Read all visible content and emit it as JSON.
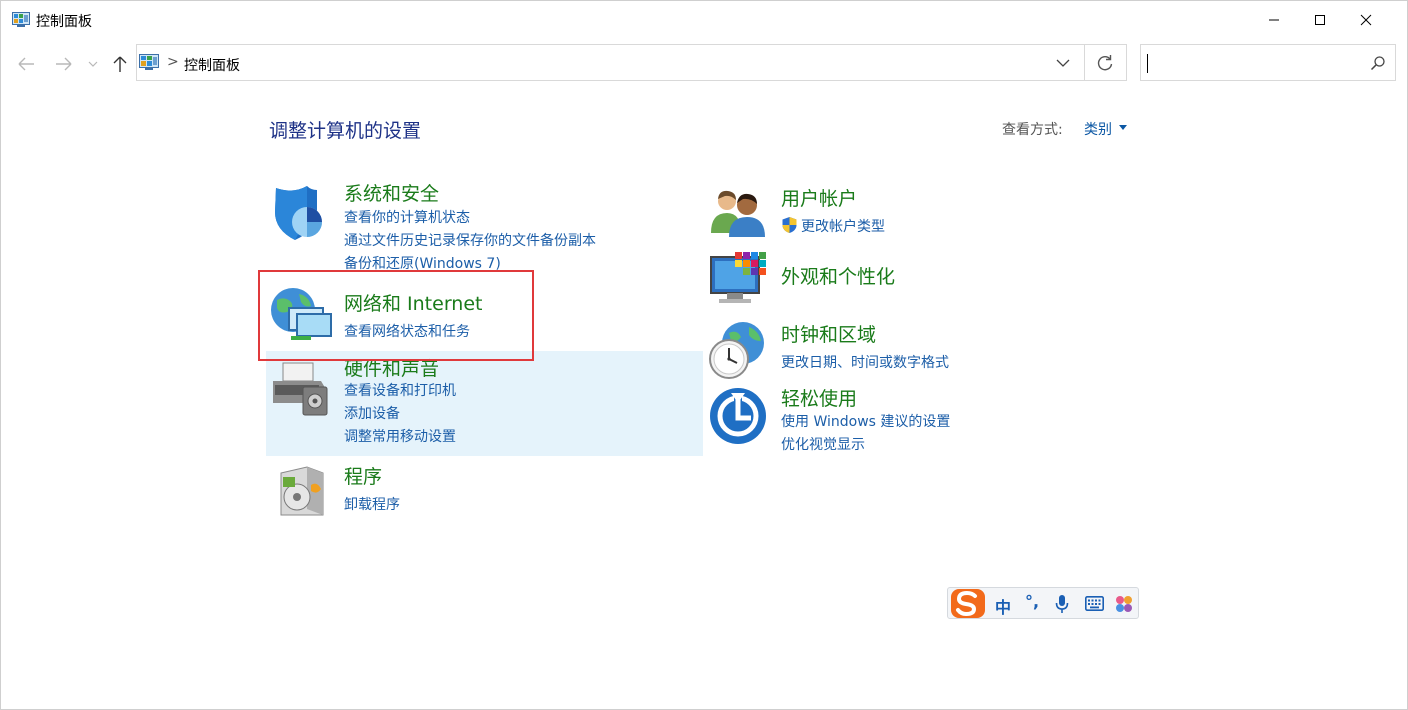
{
  "window": {
    "title": "控制面板",
    "icon": "control-panel-icon",
    "controls": [
      "minimize-icon",
      "maximize-icon",
      "close-icon"
    ]
  },
  "nav": {
    "back": "arrow-left-icon",
    "forward": "arrow-right-icon",
    "recent": "chevron-down-icon",
    "up": "arrow-up-icon"
  },
  "address": {
    "separator": ">",
    "path": "控制面板",
    "dropdown": "chevron-down-icon",
    "refresh": "refresh-icon"
  },
  "search": {
    "value": "",
    "icon": "search-icon"
  },
  "main": {
    "heading": "调整计算机的设置",
    "view_by_label": "查看方式:",
    "view_by_value": "类别"
  },
  "categories_left": [
    {
      "title": "系统和安全",
      "icon": "shield-icon",
      "links": [
        "查看你的计算机状态",
        "通过文件历史记录保存你的文件备份副本",
        "备份和还原(Windows 7)"
      ]
    },
    {
      "title": "网络和 Internet",
      "icon": "network-globe-icon",
      "links": [
        "查看网络状态和任务"
      ]
    },
    {
      "title": "硬件和声音",
      "icon": "printer-icon",
      "links": [
        "查看设备和打印机",
        "添加设备",
        "调整常用移动设置"
      ]
    },
    {
      "title": "程序",
      "icon": "programs-icon",
      "links": [
        "卸载程序"
      ]
    }
  ],
  "categories_right": [
    {
      "title": "用户帐户",
      "icon": "users-icon",
      "links": [
        "更改帐户类型"
      ],
      "link_icon": "uac-shield-icon"
    },
    {
      "title": "外观和个性化",
      "icon": "monitor-palette-icon",
      "links": []
    },
    {
      "title": "时钟和区域",
      "icon": "clock-globe-icon",
      "links": [
        "更改日期、时间或数字格式"
      ]
    },
    {
      "title": "轻松使用",
      "icon": "ease-of-access-icon",
      "links": [
        "使用 Windows 建议的设置",
        "优化视觉显示"
      ]
    }
  ],
  "ime": {
    "logo": "sogou-logo-icon",
    "mode": "中",
    "punct": "°,",
    "mic": "microphone-icon",
    "keyboard": "keyboard-icon",
    "skin": "skin-icon"
  },
  "colors": {
    "category_title": "#1a7b1a",
    "link": "#1c5ea8",
    "heading": "#1e3287",
    "highlight_border": "#e0393b",
    "hover_bg": "#e5f3fb"
  }
}
